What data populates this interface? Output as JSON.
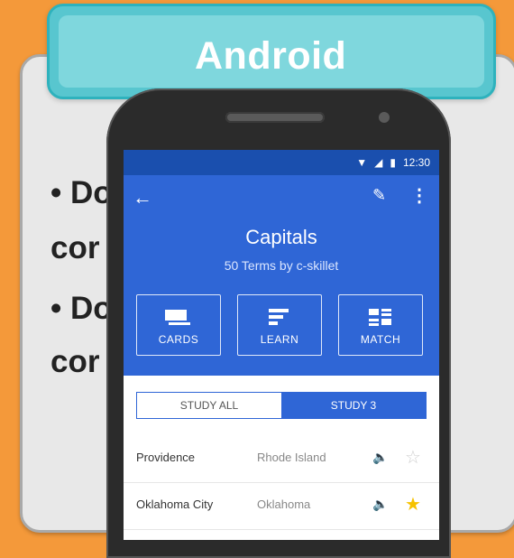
{
  "slide": {
    "title": "Android",
    "bullets": [
      "• Do",
      "cor",
      "• Do",
      "cor"
    ]
  },
  "phone": {
    "status_time": "12:30",
    "set_title": "Capitals",
    "set_subtitle": "50 Terms by c-skillet",
    "modes": [
      {
        "label": "CARDS",
        "icon": "cards-icon"
      },
      {
        "label": "LEARN",
        "icon": "learn-icon"
      },
      {
        "label": "MATCH",
        "icon": "match-icon"
      }
    ],
    "toggle": {
      "all": "STUDY ALL",
      "starred": "STUDY 3",
      "active": "starred"
    },
    "rows": [
      {
        "term": "Providence",
        "definition": "Rhode Island",
        "starred": false
      },
      {
        "term": "Oklahoma City",
        "definition": "Oklahoma",
        "starred": true
      }
    ],
    "colors": {
      "header": "#2f66d6",
      "statusbar": "#1a4fae",
      "star": "#f6c200"
    }
  }
}
